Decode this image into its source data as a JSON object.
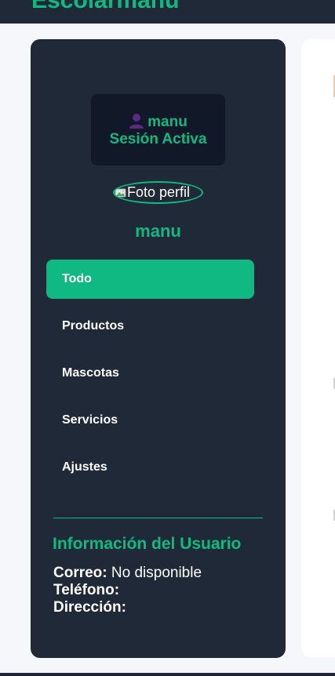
{
  "header": {
    "brand": "Escolarmanu"
  },
  "session": {
    "username": "manu",
    "status": "Sesión Activa"
  },
  "profile": {
    "photo_alt": "Foto perfil",
    "name": "manu"
  },
  "nav": {
    "items": [
      {
        "label": "Todo",
        "active": true
      },
      {
        "label": "Productos",
        "active": false
      },
      {
        "label": "Mascotas",
        "active": false
      },
      {
        "label": "Servicios",
        "active": false
      },
      {
        "label": "Ajustes",
        "active": false
      }
    ]
  },
  "user_info": {
    "title": "Información del Usuario",
    "email_label": "Correo:",
    "email_value": "No disponible",
    "phone_label": "Teléfono:",
    "phone_value": "",
    "address_label": "Dirección:",
    "address_value": ""
  },
  "colors": {
    "accent": "#10b981",
    "sidebar_bg": "#1f2937",
    "page_bg": "#f6f7fb"
  }
}
